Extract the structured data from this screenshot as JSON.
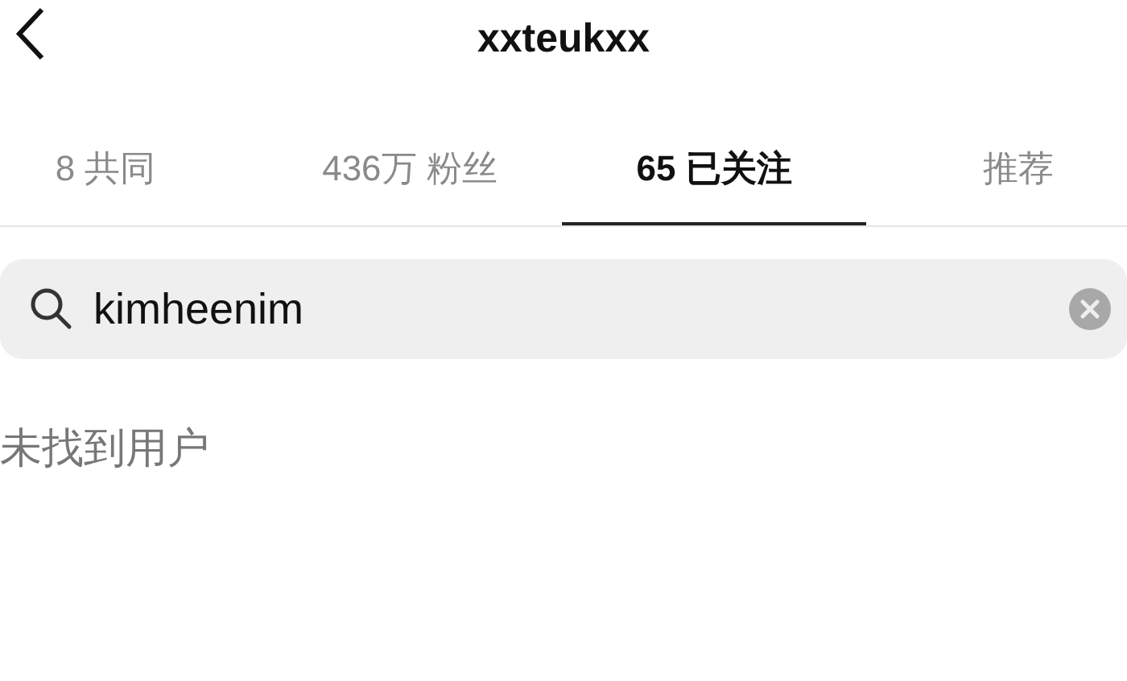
{
  "header": {
    "title": "xxteukxx"
  },
  "tabs": [
    {
      "label": "8 共同",
      "selected": false
    },
    {
      "label": "436万 粉丝",
      "selected": false
    },
    {
      "label": "65 已关注",
      "selected": true
    },
    {
      "label": "推荐",
      "selected": false
    }
  ],
  "search": {
    "value": "kimheenim"
  },
  "message": "未找到用户"
}
